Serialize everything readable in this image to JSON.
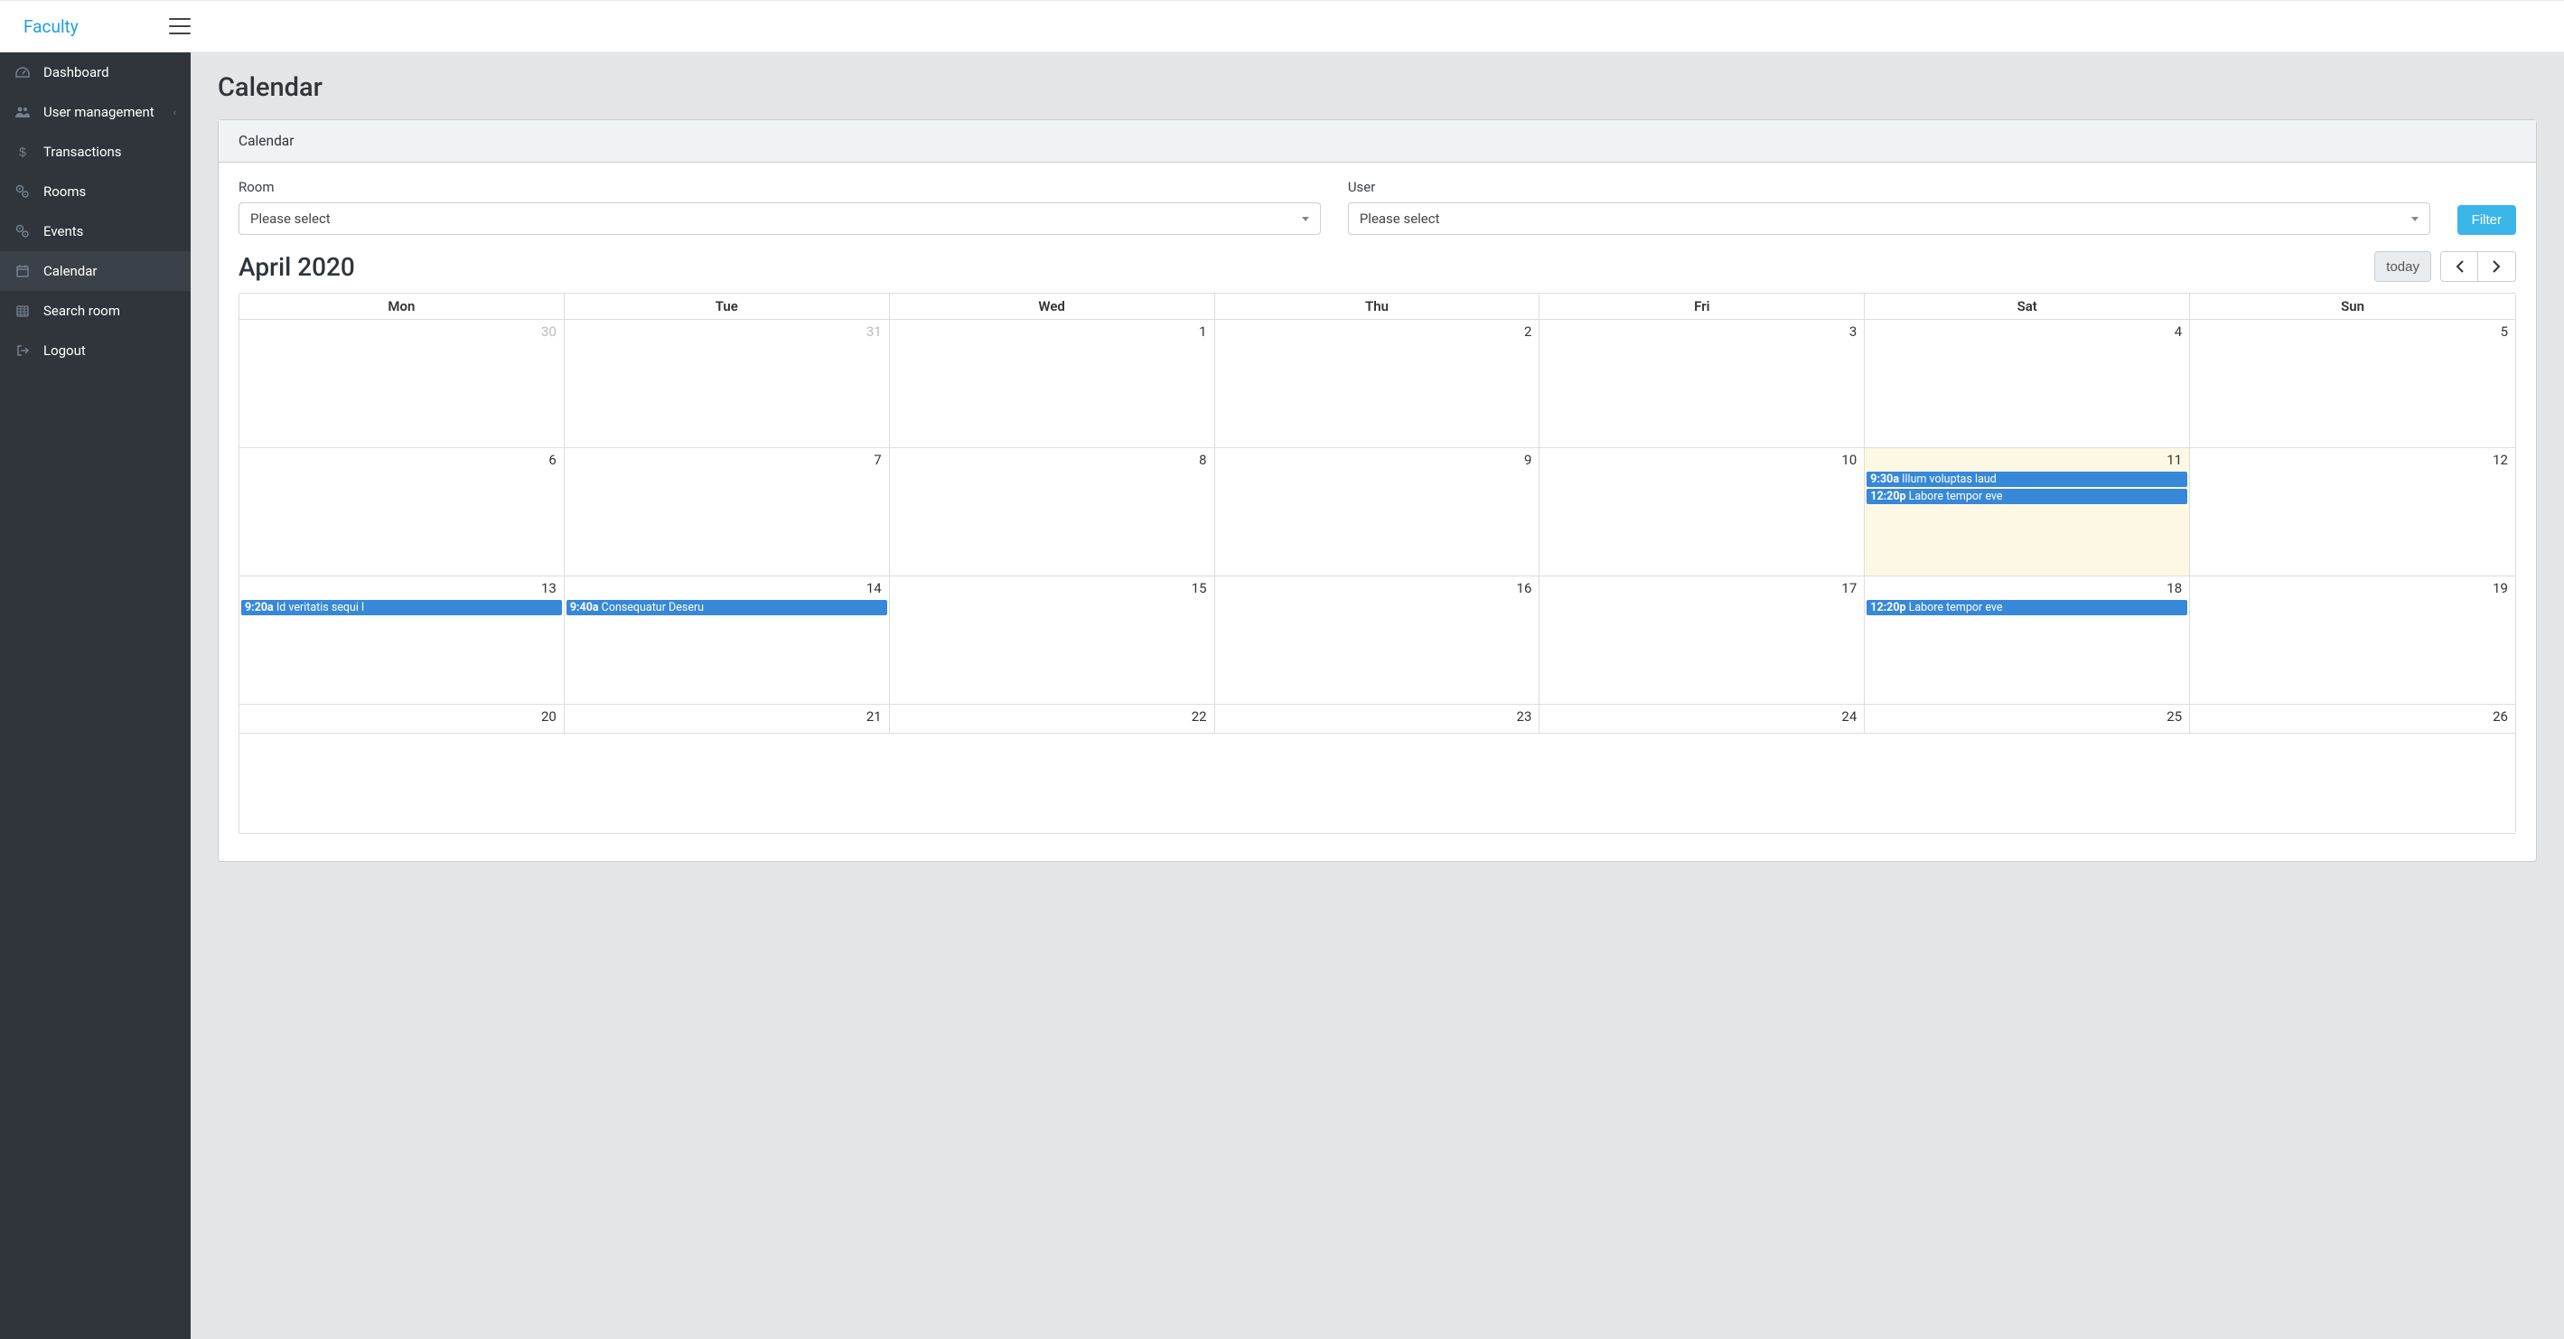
{
  "brand": "Faculty",
  "sidebar": {
    "items": [
      {
        "label": "Dashboard",
        "icon": "dashboard-icon",
        "active": false
      },
      {
        "label": "User management",
        "icon": "users-icon",
        "active": false,
        "has_children": true
      },
      {
        "label": "Transactions",
        "icon": "dollar-icon",
        "active": false
      },
      {
        "label": "Rooms",
        "icon": "cogs-icon",
        "active": false
      },
      {
        "label": "Events",
        "icon": "cogs-icon",
        "active": false
      },
      {
        "label": "Calendar",
        "icon": "calendar-icon",
        "active": true
      },
      {
        "label": "Search room",
        "icon": "calendar-grid-icon",
        "active": false
      },
      {
        "label": "Logout",
        "icon": "logout-icon",
        "active": false
      }
    ]
  },
  "page": {
    "title": "Calendar",
    "card_title": "Calendar"
  },
  "filters": {
    "room_label": "Room",
    "room_placeholder": "Please select",
    "user_label": "User",
    "user_placeholder": "Please select",
    "button": "Filter"
  },
  "calendar": {
    "title": "April 2020",
    "today_label": "today",
    "day_headers": [
      "Mon",
      "Tue",
      "Wed",
      "Thu",
      "Fri",
      "Sat",
      "Sun"
    ],
    "weeks": [
      [
        {
          "day": "30",
          "other": true
        },
        {
          "day": "31",
          "other": true
        },
        {
          "day": "1"
        },
        {
          "day": "2"
        },
        {
          "day": "3"
        },
        {
          "day": "4"
        },
        {
          "day": "5"
        }
      ],
      [
        {
          "day": "6"
        },
        {
          "day": "7"
        },
        {
          "day": "8"
        },
        {
          "day": "9"
        },
        {
          "day": "10"
        },
        {
          "day": "11",
          "today": true,
          "events": [
            {
              "time": "9:30a",
              "title": "Illum voluptas laud"
            },
            {
              "time": "12:20p",
              "title": "Labore tempor eve"
            }
          ]
        },
        {
          "day": "12"
        }
      ],
      [
        {
          "day": "13",
          "events": [
            {
              "time": "9:20a",
              "title": "Id veritatis sequi l"
            }
          ]
        },
        {
          "day": "14",
          "events": [
            {
              "time": "9:40a",
              "title": "Consequatur Deseru"
            }
          ]
        },
        {
          "day": "15"
        },
        {
          "day": "16"
        },
        {
          "day": "17"
        },
        {
          "day": "18",
          "events": [
            {
              "time": "12:20p",
              "title": "Labore tempor eve"
            }
          ]
        },
        {
          "day": "19"
        }
      ],
      [
        {
          "day": "20"
        },
        {
          "day": "21"
        },
        {
          "day": "22"
        },
        {
          "day": "23"
        },
        {
          "day": "24"
        },
        {
          "day": "25"
        },
        {
          "day": "26"
        }
      ]
    ]
  }
}
